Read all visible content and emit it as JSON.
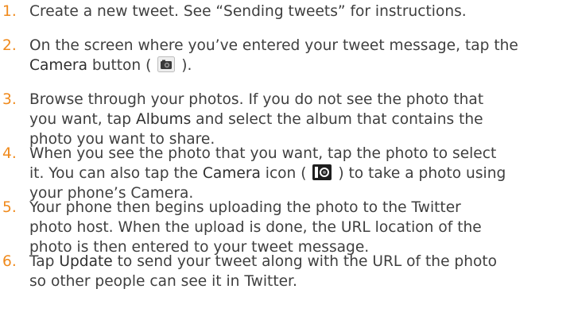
{
  "steps": [
    {
      "number": "1.",
      "line1": "Create a new tweet. See “Sending tweets” for instructions."
    },
    {
      "number": "2.",
      "line1": "On the screen where you’ve entered your tweet message, tap the",
      "l2_kw": "Camera",
      "l2_pre": " button ( ",
      "l2_post": " )."
    },
    {
      "number": "3.",
      "line1": "Browse through your photos. If you do not see the photo that",
      "l2_pre": "you want, tap ",
      "l2_kw": "Albums",
      "l2_post": " and select the album that contains the",
      "line3": "photo you want to share."
    },
    {
      "number": "4.",
      "line1": "When you see the photo that you want, tap the photo to select",
      "l2_pre": "it. You can also tap the ",
      "l2_kw": "Camera",
      "l2_mid": " icon ( ",
      "l2_post": " ) to take a photo using",
      "line3": "your phone’s Camera."
    },
    {
      "number": "5.",
      "line1": "Your phone then begins uploading the photo to the Twitter",
      "line2": "photo host. When the upload is done, the URL location of the",
      "line3": "photo is then entered to your tweet message."
    },
    {
      "number": "6.",
      "l1_pre": "Tap ",
      "l1_kw": "Update",
      "l1_post": " to send your tweet along with the URL of the photo",
      "line2": "so other people can see it in Twitter."
    }
  ],
  "icons": {
    "camera_button": "camera-button-icon",
    "camera": "camera-icon"
  }
}
